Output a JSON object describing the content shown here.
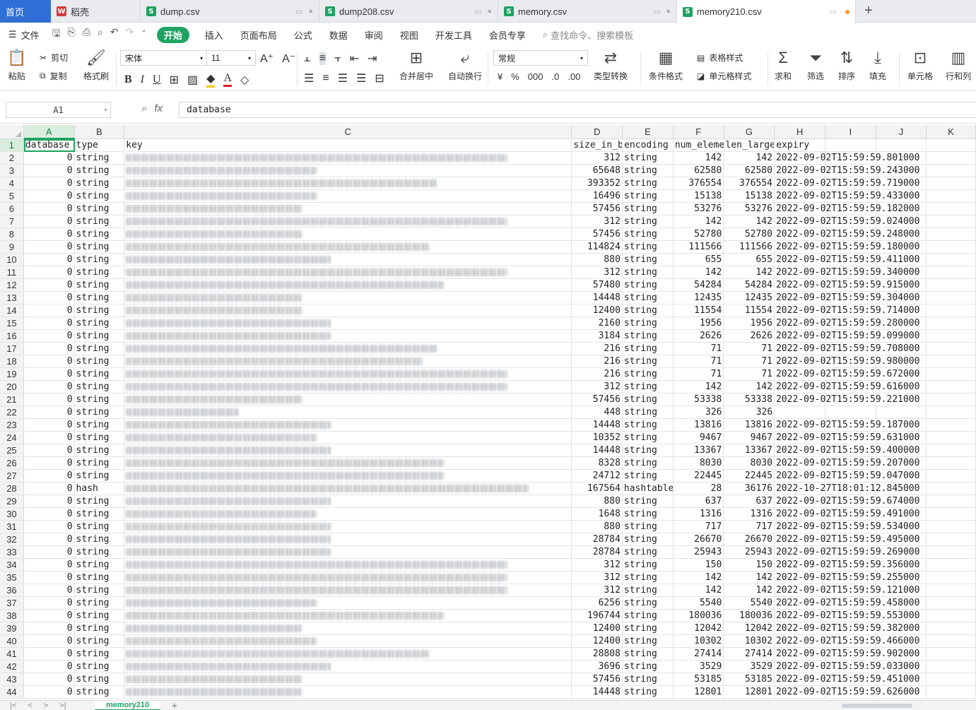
{
  "tabs": [
    {
      "label": "首页",
      "kind": "home"
    },
    {
      "label": "稻壳",
      "kind": "doc",
      "icon": "wps-icon"
    },
    {
      "label": "dump.csv",
      "kind": "file",
      "icon": "sheet-icon"
    },
    {
      "label": "dump208.csv",
      "kind": "file",
      "icon": "sheet-icon"
    },
    {
      "label": "memory.csv",
      "kind": "file",
      "icon": "sheet-icon"
    },
    {
      "label": "memory210.csv",
      "kind": "file",
      "icon": "sheet-icon",
      "active": true
    }
  ],
  "menu": {
    "file": "文件",
    "start": "开始",
    "items": [
      "插入",
      "页面布局",
      "公式",
      "数据",
      "审阅",
      "视图",
      "开发工具",
      "会员专享"
    ],
    "search": "查找命令、搜索模板"
  },
  "ribbon": {
    "paste": "粘贴",
    "cut": "剪切",
    "copy": "复制",
    "format_painter": "格式刷",
    "font_name": "宋体",
    "font_size": "11",
    "merge": "合并居中",
    "wrap": "自动换行",
    "number_format": "常规",
    "convert": "类型转换",
    "cond_format": "条件格式",
    "table_style": "表格样式",
    "cell_style": "单元格样式",
    "sum": "求和",
    "filter": "筛选",
    "sort": "排序",
    "fill": "填充",
    "cell": "单元格",
    "row_col": "行和列"
  },
  "formula_bar": {
    "name_box": "A1",
    "fx": "fx",
    "content": "database"
  },
  "columns": [
    "A",
    "B",
    "C",
    "D",
    "E",
    "F",
    "G",
    "H",
    "I",
    "J",
    "K"
  ],
  "header_row": [
    "database",
    "type",
    "key",
    "size_in_b",
    "encoding",
    "num_eleme",
    "len_large",
    "expiry",
    "",
    "",
    ""
  ],
  "rows": [
    [
      "0",
      "string",
      "",
      312,
      "string",
      142,
      142,
      "2022-09-02T15:59:59.801000"
    ],
    [
      "0",
      "string",
      "",
      65648,
      "string",
      62580,
      62580,
      "2022-09-02T15:59:59.243000"
    ],
    [
      "0",
      "string",
      "",
      393352,
      "string",
      376554,
      376554,
      "2022-09-02T15:59:59.719000"
    ],
    [
      "0",
      "string",
      "",
      16496,
      "string",
      15138,
      15138,
      "2022-09-02T15:59:59.433000"
    ],
    [
      "0",
      "string",
      "",
      57456,
      "string",
      53276,
      53276,
      "2022-09-02T15:59:59.182000"
    ],
    [
      "0",
      "string",
      "",
      312,
      "string",
      142,
      142,
      "2022-09-02T15:59:59.024000"
    ],
    [
      "0",
      "string",
      "",
      57456,
      "string",
      52780,
      52780,
      "2022-09-02T15:59:59.248000"
    ],
    [
      "0",
      "string",
      "",
      114824,
      "string",
      111566,
      111566,
      "2022-09-02T15:59:59.180000"
    ],
    [
      "0",
      "string",
      "",
      880,
      "string",
      655,
      655,
      "2022-09-02T15:59:59.411000"
    ],
    [
      "0",
      "string",
      "",
      312,
      "string",
      142,
      142,
      "2022-09-02T15:59:59.340000"
    ],
    [
      "0",
      "string",
      "",
      57480,
      "string",
      54284,
      54284,
      "2022-09-02T15:59:59.915000"
    ],
    [
      "0",
      "string",
      "",
      14448,
      "string",
      12435,
      12435,
      "2022-09-02T15:59:59.304000"
    ],
    [
      "0",
      "string",
      "",
      12400,
      "string",
      11554,
      11554,
      "2022-09-02T15:59:59.714000"
    ],
    [
      "0",
      "string",
      "",
      2160,
      "string",
      1956,
      1956,
      "2022-09-02T15:59:59.280000"
    ],
    [
      "0",
      "string",
      "",
      3184,
      "string",
      2626,
      2626,
      "2022-09-02T15:59:59.099000"
    ],
    [
      "0",
      "string",
      "",
      216,
      "string",
      71,
      71,
      "2022-09-02T15:59:59.708000"
    ],
    [
      "0",
      "string",
      "",
      216,
      "string",
      71,
      71,
      "2022-09-02T15:59:59.980000"
    ],
    [
      "0",
      "string",
      "",
      216,
      "string",
      71,
      71,
      "2022-09-02T15:59:59.672000"
    ],
    [
      "0",
      "string",
      "",
      312,
      "string",
      142,
      142,
      "2022-09-02T15:59:59.616000"
    ],
    [
      "0",
      "string",
      "",
      57456,
      "string",
      53338,
      53338,
      "2022-09-02T15:59:59.221000"
    ],
    [
      "0",
      "string",
      "",
      448,
      "string",
      326,
      326,
      ""
    ],
    [
      "0",
      "string",
      "",
      14448,
      "string",
      13816,
      13816,
      "2022-09-02T15:59:59.187000"
    ],
    [
      "0",
      "string",
      "",
      10352,
      "string",
      9467,
      9467,
      "2022-09-02T15:59:59.631000"
    ],
    [
      "0",
      "string",
      "",
      14448,
      "string",
      13367,
      13367,
      "2022-09-02T15:59:59.400000"
    ],
    [
      "0",
      "string",
      "",
      8328,
      "string",
      8030,
      8030,
      "2022-09-02T15:59:59.207000"
    ],
    [
      "0",
      "string",
      "",
      24712,
      "string",
      22445,
      22445,
      "2022-09-02T15:59:59.047000"
    ],
    [
      "0",
      "hash",
      "",
      167564,
      "hashtable",
      28,
      36176,
      "2022-10-27T18:01:12.845000"
    ],
    [
      "0",
      "string",
      "",
      880,
      "string",
      637,
      637,
      "2022-09-02T15:59:59.674000"
    ],
    [
      "0",
      "string",
      "",
      1648,
      "string",
      1316,
      1316,
      "2022-09-02T15:59:59.491000"
    ],
    [
      "0",
      "string",
      "",
      880,
      "string",
      717,
      717,
      "2022-09-02T15:59:59.534000"
    ],
    [
      "0",
      "string",
      "",
      28784,
      "string",
      26670,
      26670,
      "2022-09-02T15:59:59.495000"
    ],
    [
      "0",
      "string",
      "",
      28784,
      "string",
      25943,
      25943,
      "2022-09-02T15:59:59.269000"
    ],
    [
      "0",
      "string",
      "",
      312,
      "string",
      150,
      150,
      "2022-09-02T15:59:59.356000"
    ],
    [
      "0",
      "string",
      "",
      312,
      "string",
      142,
      142,
      "2022-09-02T15:59:59.255000"
    ],
    [
      "0",
      "string",
      "",
      312,
      "string",
      142,
      142,
      "2022-09-02T15:59:59.121000"
    ],
    [
      "0",
      "string",
      "",
      6256,
      "string",
      5540,
      5540,
      "2022-09-02T15:59:59.458000"
    ],
    [
      "0",
      "string",
      "",
      196744,
      "string",
      180036,
      180036,
      "2022-09-02T15:59:59.553000"
    ],
    [
      "0",
      "string",
      "",
      12400,
      "string",
      12042,
      12042,
      "2022-09-02T15:59:59.382000"
    ],
    [
      "0",
      "string",
      "",
      12400,
      "string",
      10302,
      10302,
      "2022-09-02T15:59:59.466000"
    ],
    [
      "0",
      "string",
      "",
      28808,
      "string",
      27414,
      27414,
      "2022-09-02T15:59:59.902000"
    ],
    [
      "0",
      "string",
      "",
      3696,
      "string",
      3529,
      3529,
      "2022-09-02T15:59:59.033000"
    ],
    [
      "0",
      "string",
      "",
      57456,
      "string",
      53185,
      53185,
      "2022-09-02T15:59:59.451000"
    ],
    [
      "0",
      "string",
      "",
      14448,
      "string",
      12801,
      12801,
      "2022-09-02T15:59:59.626000"
    ]
  ],
  "sheet_tab": "memory210",
  "colors": {
    "accent": "#1ea362",
    "home_tab": "#2f6fd6",
    "modified_dot": "#f29a2e"
  }
}
